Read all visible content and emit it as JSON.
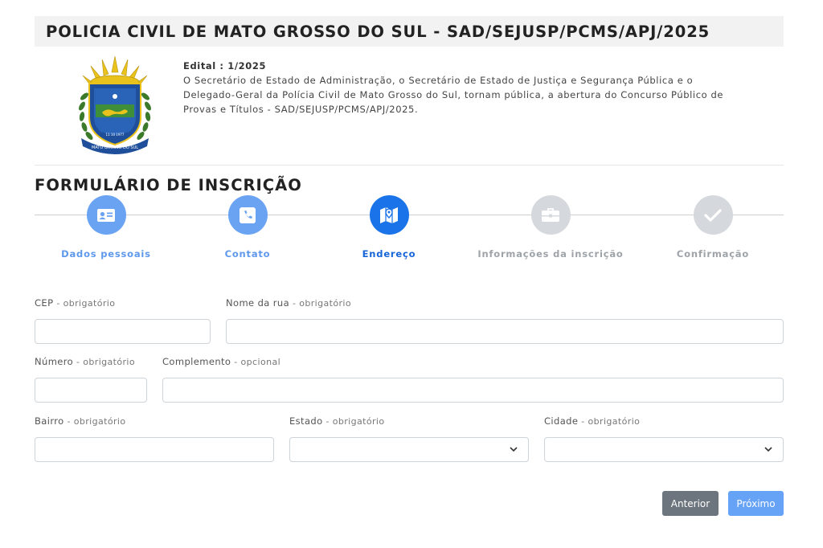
{
  "header": {
    "title": "POLICIA CIVIL DE MATO GROSSO DO SUL - SAD/SEJUSP/PCMS/APJ/2025",
    "edital_label": "Edital : 1/2025",
    "edital_text": "O Secretário de Estado de Administração, o Secretário de Estado de Justiça e Segurança Pública e o Delegado-Geral da Polícia Civil de Mato Grosso do Sul, tornam pública, a abertura do Concurso Público de Provas e Títulos - SAD/SEJUSP/PCMS/APJ/2025."
  },
  "form": {
    "title": "FORMULÁRIO DE INSCRIÇÃO",
    "steps": [
      {
        "label": "Dados pessoais",
        "icon": "id-card-icon",
        "state": "done"
      },
      {
        "label": "Contato",
        "icon": "phone-icon",
        "state": "done"
      },
      {
        "label": "Endereço",
        "icon": "map-icon",
        "state": "active"
      },
      {
        "label": "Informações da inscrição",
        "icon": "briefcase-icon",
        "state": "todo"
      },
      {
        "label": "Confirmação",
        "icon": "check-icon",
        "state": "todo"
      }
    ],
    "fields": {
      "cep": {
        "label": "CEP",
        "req": " - obrigatório",
        "value": ""
      },
      "rua": {
        "label": "Nome da rua",
        "req": " - obrigatório",
        "value": ""
      },
      "numero": {
        "label": "Número",
        "req": " - obrigatório",
        "value": ""
      },
      "complemento": {
        "label": "Complemento",
        "req": " - opcional",
        "value": ""
      },
      "bairro": {
        "label": "Bairro",
        "req": " - obrigatório",
        "value": ""
      },
      "estado": {
        "label": "Estado",
        "req": " - obrigatório",
        "value": ""
      },
      "cidade": {
        "label": "Cidade",
        "req": " - obrigatório",
        "value": ""
      }
    },
    "buttons": {
      "prev": "Anterior",
      "next": "Próximo"
    }
  },
  "colors": {
    "done": "#6aa3f2",
    "active": "#1a73e8",
    "todo": "#d5d8dc",
    "prev_button": "#6c757d",
    "next_button": "#66a3f7"
  }
}
